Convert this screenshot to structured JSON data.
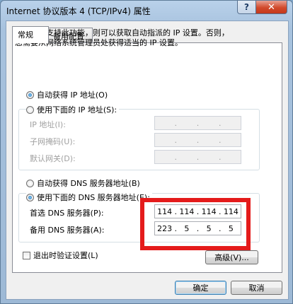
{
  "window": {
    "title": "Internet 协议版本 4 (TCP/IPv4) 属性",
    "help_label": "?",
    "close_label": "✕"
  },
  "tabs": [
    {
      "label": "常规",
      "active": true
    },
    {
      "label": "备用配置",
      "active": false
    }
  ],
  "description": {
    "line1": "如果网络支持此功能，则可以获取自动指派的 IP 设置。否则，",
    "line2": "您需要从网络系统管理员处获得适当的 IP 设置。"
  },
  "ip": {
    "auto_label": "自动获得 IP 地址(O)",
    "auto_selected": true,
    "manual_label": "使用下面的 IP 地址(S):",
    "manual_selected": false,
    "fields": [
      {
        "label": "IP 地址(I):",
        "segments": [
          "",
          "",
          "",
          ""
        ]
      },
      {
        "label": "子网掩码(U):",
        "segments": [
          "",
          "",
          "",
          ""
        ]
      },
      {
        "label": "默认网关(D):",
        "segments": [
          "",
          "",
          "",
          ""
        ]
      }
    ]
  },
  "dns": {
    "auto_label": "自动获得 DNS 服务器地址(B)",
    "auto_selected": false,
    "manual_label": "使用下面的 DNS 服务器地址(E):",
    "manual_selected": true,
    "preferred": {
      "label": "首选 DNS 服务器(P):",
      "segments": [
        "114",
        "114",
        "114",
        "114"
      ]
    },
    "alternate": {
      "label": "备用 DNS 服务器(A):",
      "segments": [
        "223",
        "5",
        "5",
        "5"
      ]
    }
  },
  "validate": {
    "label": "退出时验证设置(L)",
    "checked": false
  },
  "buttons": {
    "advanced": "高级(V)...",
    "ok": "确定",
    "cancel": "取消"
  },
  "colors": {
    "highlight": "#e41b1b"
  }
}
